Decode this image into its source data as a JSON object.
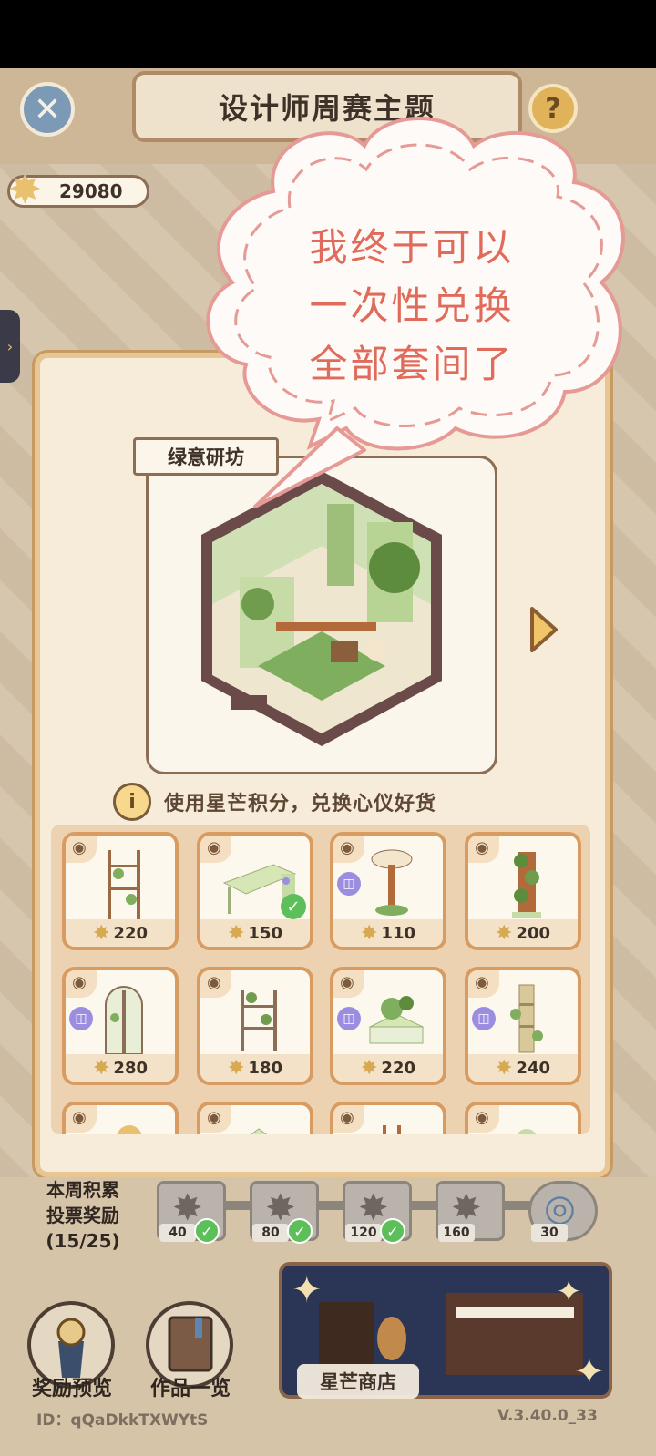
{
  "header": {
    "title": "设计师周赛主题"
  },
  "wallet": {
    "points": "29080"
  },
  "dialog": {
    "room_name": "绿意研坊",
    "info_text": "使用星芒积分，兑换心仪好货",
    "items": [
      {
        "price": "220",
        "owned": false,
        "badge": false
      },
      {
        "price": "150",
        "owned": true,
        "badge": false
      },
      {
        "price": "110",
        "owned": false,
        "badge": true
      },
      {
        "price": "200",
        "owned": false,
        "badge": false
      },
      {
        "price": "280",
        "owned": false,
        "badge": true
      },
      {
        "price": "180",
        "owned": false,
        "badge": false
      },
      {
        "price": "220",
        "owned": false,
        "badge": true
      },
      {
        "price": "240",
        "owned": false,
        "badge": true
      }
    ]
  },
  "votes": {
    "label_line1": "本周积累",
    "label_line2": "投票奖励",
    "label_line3": "(15/25)",
    "tiers": [
      "40",
      "80",
      "120",
      "160",
      "30"
    ]
  },
  "bottom": {
    "rewards_label": "奖励预览",
    "works_label": "作品一览",
    "shop_label": "星芒商店",
    "user_id": "ID：qQaDkkTXWYtS",
    "version": "V.3.40.0_33"
  },
  "bubble": {
    "line1": "我终于可以",
    "line2": "一次性兑换",
    "line3": "全部套间了"
  },
  "colors": {
    "accent": "#d89c63",
    "bubble_text": "#e06b5a",
    "owned": "#5cbf5a"
  }
}
